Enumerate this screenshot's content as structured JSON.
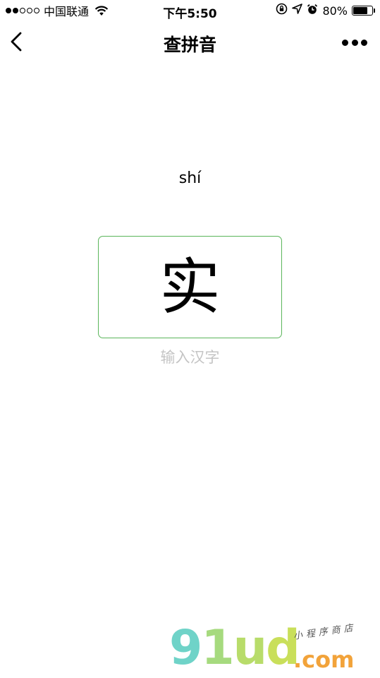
{
  "status_bar": {
    "carrier": "中国联通",
    "time": "下午5:50",
    "battery_percent": "80%",
    "battery_level": 0.8,
    "signal_filled": 2,
    "signal_total": 5
  },
  "nav": {
    "title": "查拼音"
  },
  "main": {
    "pinyin": "shí",
    "character": "实",
    "hint": "输入汉字"
  },
  "watermark": {
    "logo": "91ud",
    "domain": ".com",
    "tagline": "小程序商店"
  },
  "colors": {
    "input_border": "#5ab55a",
    "hint_text": "#c4c4c4"
  }
}
